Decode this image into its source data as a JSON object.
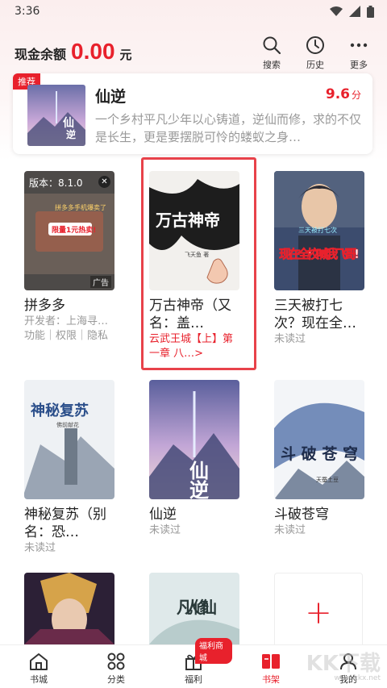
{
  "status": {
    "time": "3:36"
  },
  "header": {
    "balance_label": "现金余额",
    "balance_amount": "0.00",
    "balance_unit": "元",
    "actions": [
      {
        "label": "搜索",
        "icon": "search-icon"
      },
      {
        "label": "历史",
        "icon": "clock-icon"
      },
      {
        "label": "更多",
        "icon": "more-icon"
      }
    ]
  },
  "recommend": {
    "badge": "推荐",
    "title": "仙逆",
    "score": "9.6",
    "score_unit": "分",
    "description": "一个乡村平凡少年以心铸道，逆仙而修，求的不仅是长生，更是要摆脱可怜的蝼蚁之身…"
  },
  "ad": {
    "version": "版本：8.1.0",
    "close": "✕",
    "ad_label": "广告",
    "banner_text": "拼多多手机爆卖了",
    "banner_sub": "限量1元热卖!",
    "title": "拼多多",
    "developer": "开发者：上海寻…",
    "links": "功能｜权限｜隐私"
  },
  "books": [
    {
      "title": "万古神帝（又名：盖…",
      "status": "云武王城【上】第一章 八…>",
      "cover_text": "万古神帝",
      "author": "飞天鱼 著"
    },
    {
      "title": "三天被打七次？现在全…",
      "status": "未读过",
      "cover_text": "现在全校喊我飞哥!",
      "cover_top": "三天被打七次"
    },
    {
      "title": "神秘复苏（别名：恐…",
      "status": "未读过",
      "cover_text": "神秘复苏",
      "author": "佛前献花"
    },
    {
      "title": "仙逆",
      "status": "未读过",
      "cover_text": "仙逆"
    },
    {
      "title": "斗破苍穹",
      "status": "未读过",
      "cover_text": "斗破苍穹",
      "author": "天蚕土豆"
    },
    {
      "title": "",
      "status": "",
      "cover_text": ""
    },
    {
      "title": "",
      "status": "",
      "cover_text": "凡人修仙"
    }
  ],
  "add_button": "+",
  "nav": [
    {
      "label": "书城",
      "icon": "home-icon"
    },
    {
      "label": "分类",
      "icon": "grid-icon"
    },
    {
      "label": "福利",
      "icon": "gift-icon",
      "badge": "福利商城"
    },
    {
      "label": "书架",
      "icon": "bookshelf-icon",
      "active": true
    },
    {
      "label": "我的",
      "icon": "user-icon"
    }
  ],
  "watermark": "KK下载",
  "watermark_url": "www.kkx.net",
  "colors": {
    "accent": "#e8212c",
    "text": "#222222",
    "muted": "#999999"
  }
}
